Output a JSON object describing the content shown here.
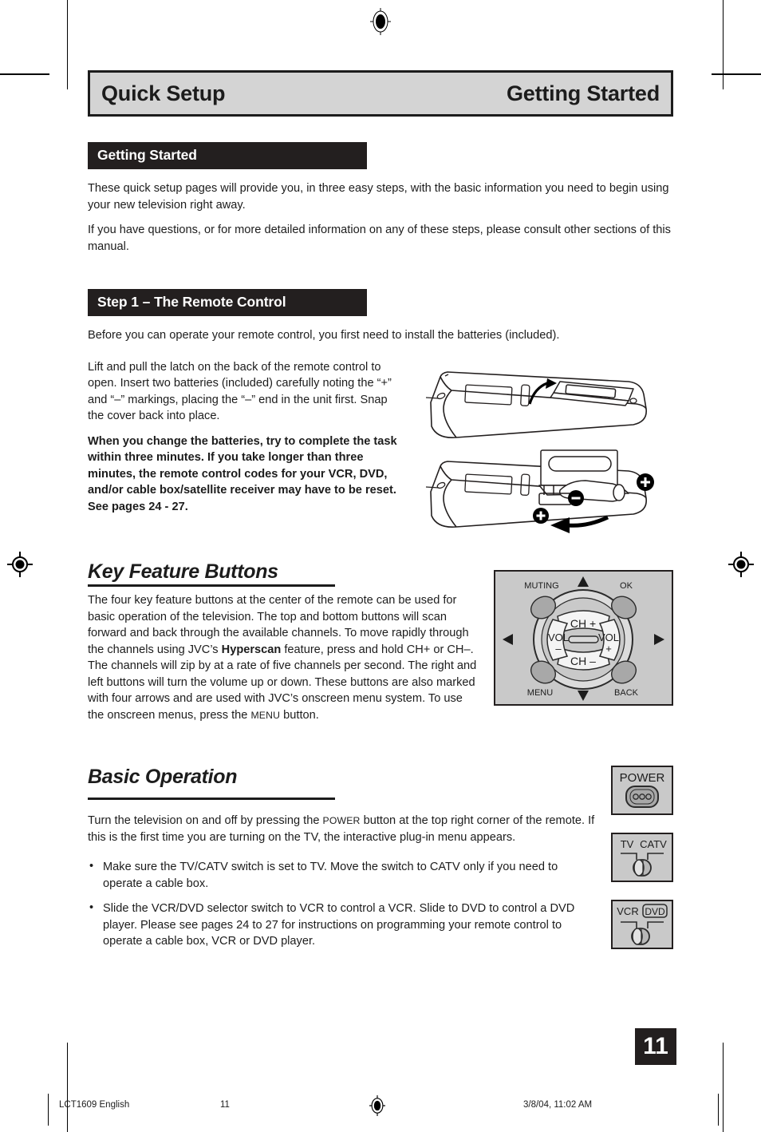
{
  "header": {
    "left_title": "Quick Setup",
    "right_title": "Getting Started"
  },
  "sections": {
    "getting_started": {
      "banner": "Getting Started",
      "paragraphs": [
        "These quick setup pages will provide you, in three easy steps, with the basic information you need to begin using your new television right away.",
        "If you have questions, or for more detailed information on any of these steps, please consult other sections of this manual."
      ]
    },
    "step1": {
      "banner": "Step 1 – The Remote Control",
      "intro": "Before you can operate your remote control, you first need to install the batteries (included).",
      "paragraph": "Lift and pull the latch on the back of the remote control to open. Insert two batteries (included) carefully noting the “+” and “–” markings, placing the “–” end in the unit first. Snap the cover back into place.",
      "warning": "When you change the batteries, try to complete the task within three minutes. If you take longer than three minutes, the remote control codes for your VCR, DVD, and/or cable box/satellite receiver may have to be reset. See pages 24 - 27."
    },
    "key_feature": {
      "heading": "Key Feature Buttons",
      "body_part1": "The four key feature buttons at the center of the remote can be used for basic operation of the television. The top and bottom buttons will scan forward and back through the available channels. To move rapidly through the channels using JVC’s ",
      "body_bold1": "Hyperscan",
      "body_part2": " feature, press and hold CH+ or CH–. The channels will zip by at a rate of five channels per second. The right and left buttons will turn the volume up or down. These buttons are also marked with four arrows and are used with JVC’s onscreen menu system. To use the onscreen menus, press the ",
      "body_smallcaps": "Menu",
      "body_part3": " button."
    },
    "basic_operation": {
      "heading": "Basic Operation",
      "body_part1": "Turn the television on and off by pressing the ",
      "body_smallcaps": "Power",
      "body_part2": " button at the top right corner of the remote. If this is the first time you are turning on the TV, the interactive plug-in menu appears.",
      "bullets": [
        "Make sure the TV/CATV switch is set to TV. Move the switch to CATV only if you need to operate a cable box.",
        "Slide the VCR/DVD selector switch to VCR to control a VCR. Slide to DVD to control a DVD player. Please see pages 24 to 27 for instructions on programming your remote control to operate a cable box, VCR or DVD player."
      ]
    }
  },
  "diagrams": {
    "key_feature_buttons": {
      "muting": "MUTING",
      "ok": "OK",
      "menu": "MENU",
      "back": "BACK",
      "ch_up": "CH +",
      "ch_down": "CH –",
      "vol_down_line1": "VOL",
      "vol_down_line2": "–",
      "vol_up_line1": "VOL",
      "vol_up_line2": "+",
      "background_color": "#c9c9c9",
      "border_color": "#231f1f",
      "button_gray": "#a8a8a8",
      "button_light": "#f2f2f2"
    },
    "power": {
      "label": "POWER"
    },
    "tv_catv": {
      "label_left": "TV",
      "label_right": "CATV"
    },
    "vcr_dvd": {
      "label_left": "VCR",
      "label_right": "DVD"
    },
    "battery_plus": "+",
    "battery_minus": "–"
  },
  "page_number_badge": "11",
  "footer": {
    "document_id": "LCT1609 English",
    "page": "11",
    "timestamp": "3/8/04, 11:02 AM"
  }
}
